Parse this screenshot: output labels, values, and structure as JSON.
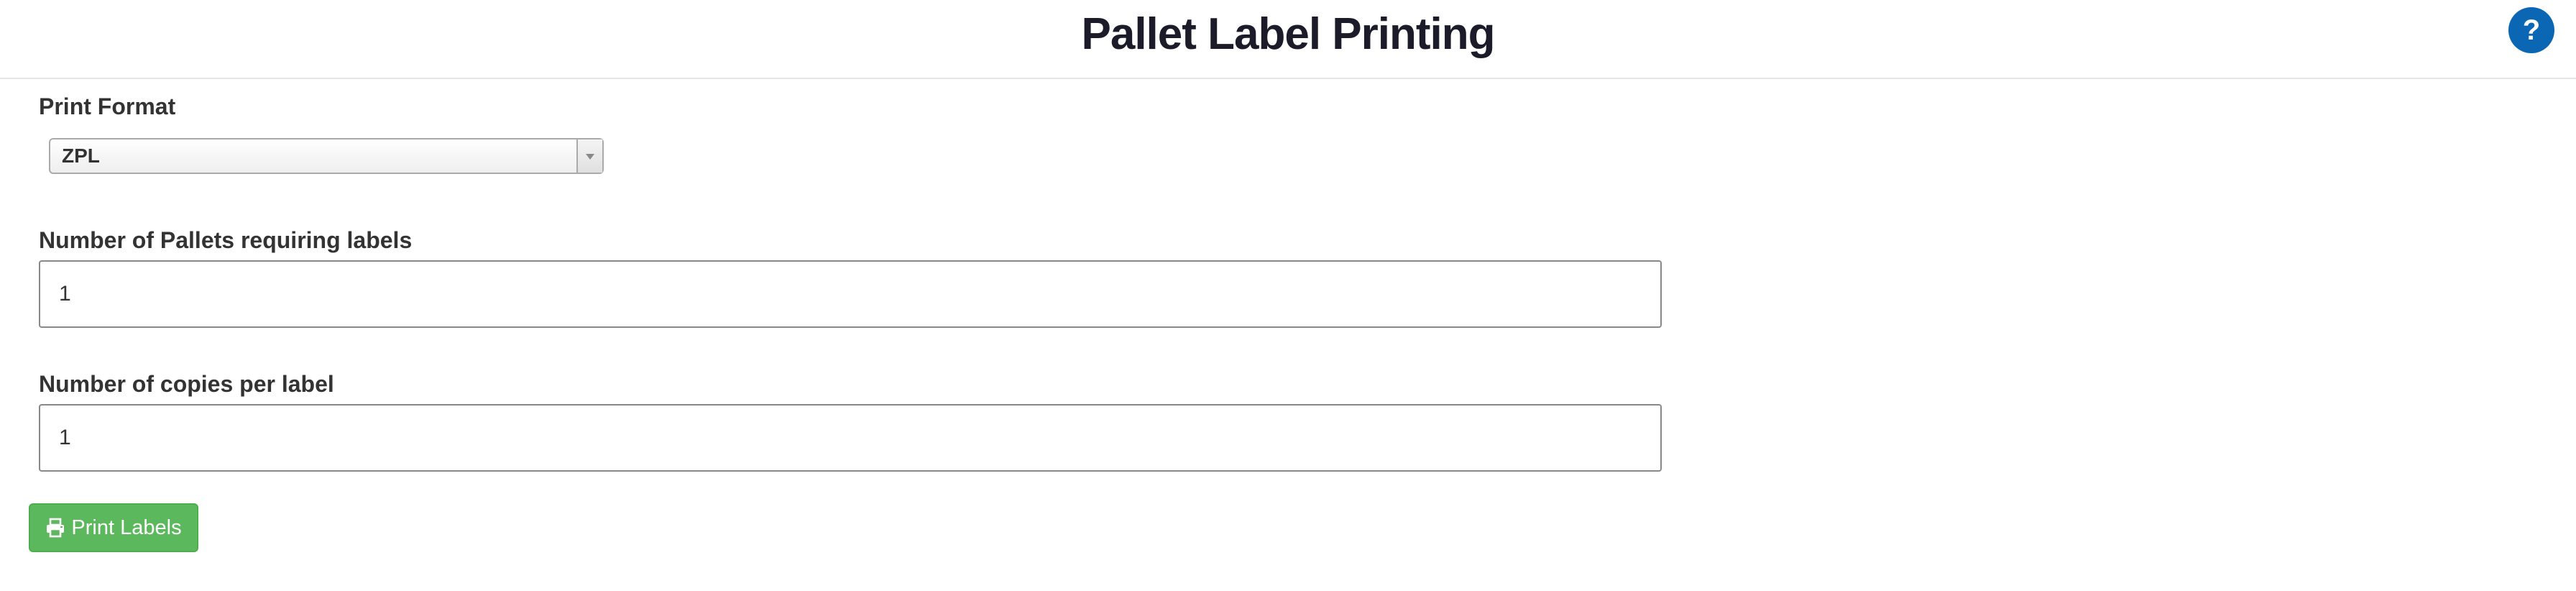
{
  "header": {
    "title": "Pallet Label Printing",
    "help_label": "?"
  },
  "form": {
    "print_format": {
      "label": "Print Format",
      "selected": "ZPL"
    },
    "pallets": {
      "label": "Number of Pallets requiring labels",
      "value": "1"
    },
    "copies": {
      "label": "Number of copies per label",
      "value": "1"
    },
    "print_button": {
      "label": "Print Labels",
      "icon": "printer-icon"
    }
  },
  "colors": {
    "help_button": "#0b66b3",
    "print_button": "#5cb85c",
    "title": "#1b1b2a"
  }
}
